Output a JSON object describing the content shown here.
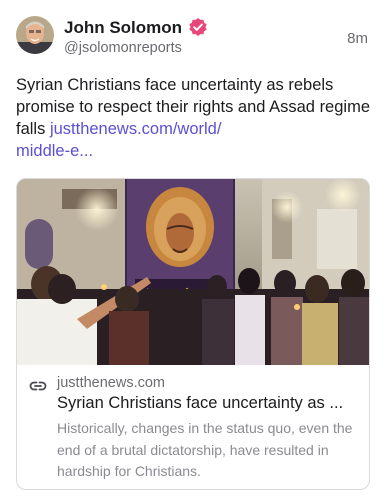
{
  "author": {
    "name": "John Solomon",
    "handle": "@jsolomonreports",
    "verified_icon": "verified-badge-icon",
    "verified_color": "#e8477a"
  },
  "timestamp": "8m",
  "post": {
    "text": "Syrian Christians face uncertainty as rebels promise to respect their rights and Assad regime falls ",
    "link_text": "justthenews.com/world/\nmiddle-e..."
  },
  "link_card": {
    "icon": "link-icon",
    "domain": "justthenews.com",
    "title": "Syrian Christians face uncertainty as ...",
    "description": "Historically, changes in the status quo, even the end of a brutal dictatorship, have resulted in hardship for Christians."
  },
  "colors": {
    "link": "#5b4fd6",
    "text": "#1c1c1e",
    "secondary": "#6b6b70"
  }
}
